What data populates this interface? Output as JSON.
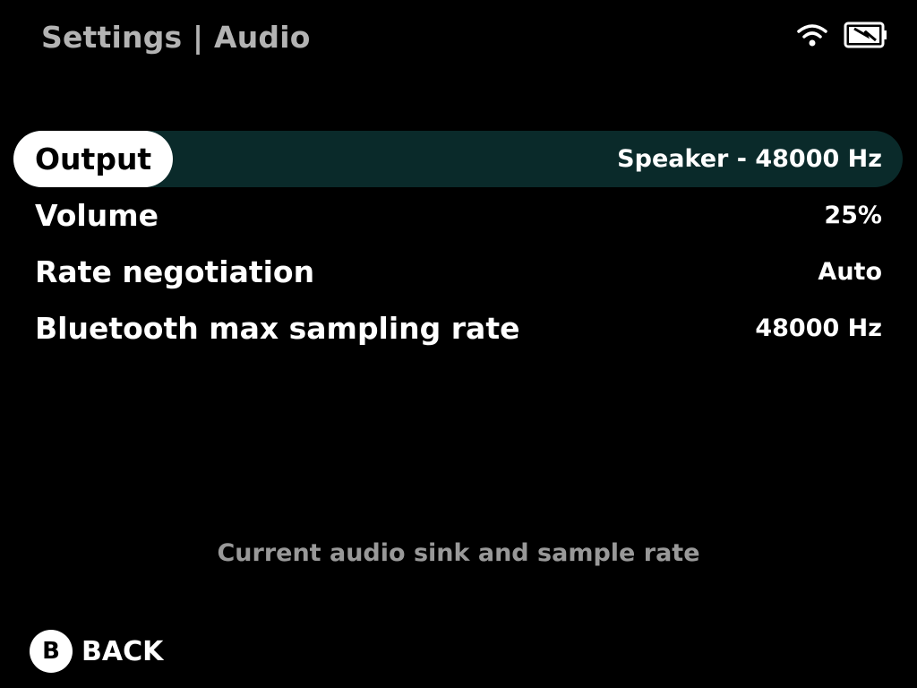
{
  "header": {
    "title": "Settings | Audio"
  },
  "status": {
    "wifi_icon": "wifi-icon",
    "battery_icon": "battery-charging-icon"
  },
  "menu": {
    "items": [
      {
        "label": "Output",
        "value": "Speaker - 48000 Hz",
        "selected": true
      },
      {
        "label": "Volume",
        "value": "25%"
      },
      {
        "label": "Rate negotiation",
        "value": "Auto"
      },
      {
        "label": "Bluetooth max sampling rate",
        "value": "48000 Hz"
      }
    ]
  },
  "hint": "Current audio sink and sample rate",
  "footer": {
    "button_glyph": "B",
    "back_label": "BACK"
  },
  "colors": {
    "background": "#000000",
    "selected_row": "#0a2a2a",
    "selected_pill": "#ffffff",
    "title": "#b3b3b3",
    "hint": "#999999"
  }
}
